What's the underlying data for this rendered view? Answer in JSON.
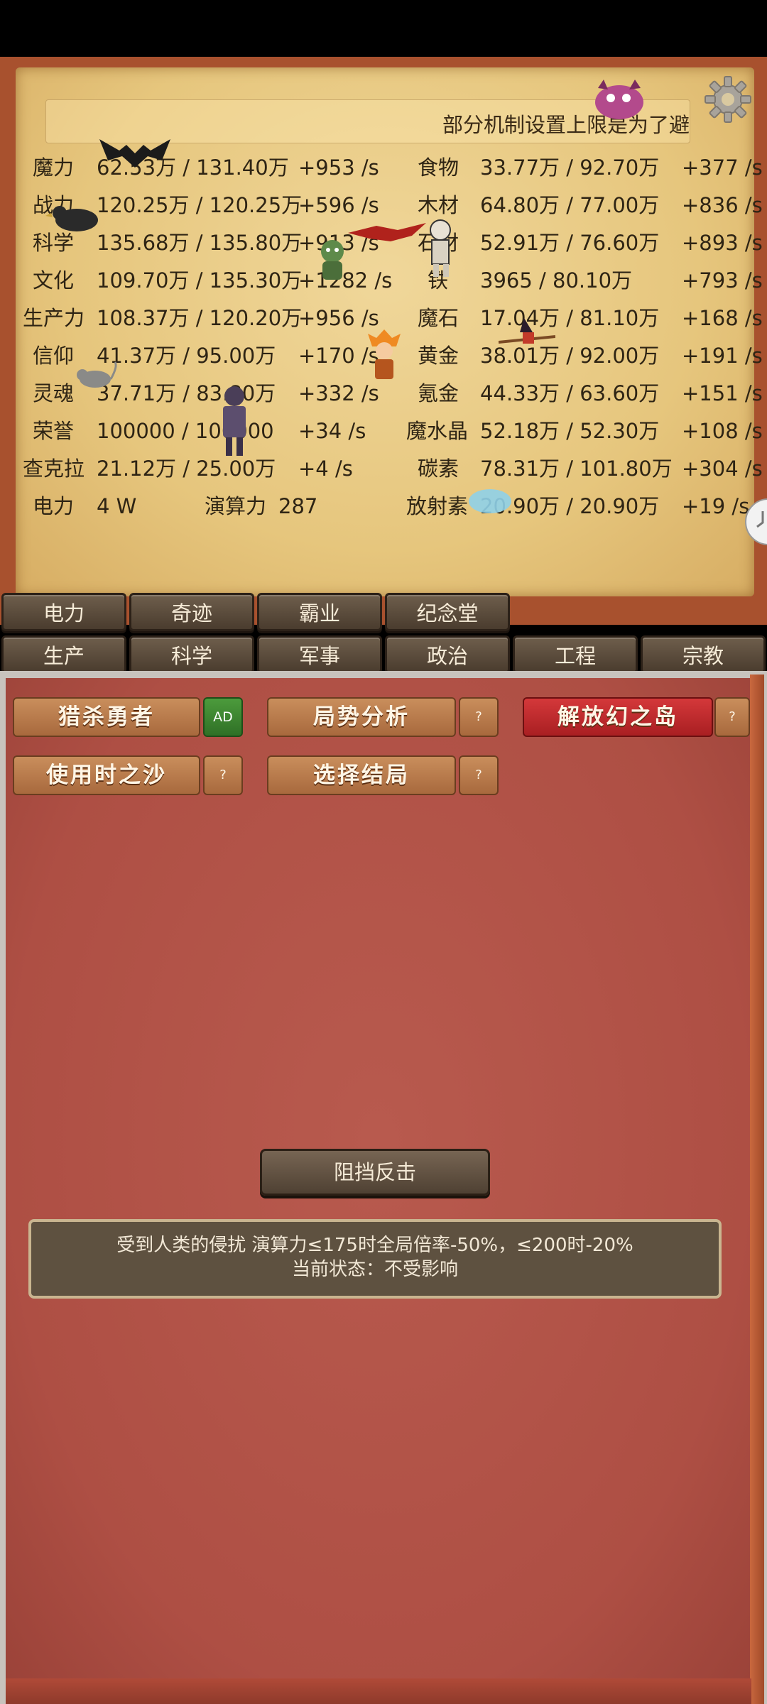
{
  "notice_text": "部分机制设置上限是为了避",
  "stats_left": [
    {
      "name": "魔力",
      "amount": "62.53万 / 131.40万",
      "rate": "+953 /s"
    },
    {
      "name": "战力",
      "amount": "120.25万 / 120.25万",
      "rate": "+596 /s"
    },
    {
      "name": "科学",
      "amount": "135.68万 / 135.80万",
      "rate": "+913 /s"
    },
    {
      "name": "文化",
      "amount": "109.70万 / 135.30万",
      "rate": "+1282 /s"
    },
    {
      "name": "生产力",
      "amount": "108.37万 / 120.20万",
      "rate": "+956 /s"
    },
    {
      "name": "信仰",
      "amount": "41.37万 / 95.00万",
      "rate": "+170 /s"
    },
    {
      "name": "灵魂",
      "amount": "37.71万 / 83.80万",
      "rate": "+332 /s"
    },
    {
      "name": "荣誉",
      "amount": "100000 / 100000",
      "rate": "+34 /s"
    },
    {
      "name": "查克拉",
      "amount": "21.12万 / 25.00万",
      "rate": "+4 /s"
    }
  ],
  "stats_right": [
    {
      "name": "食物",
      "amount": "33.77万 / 92.70万",
      "rate": "+377 /s"
    },
    {
      "name": "木材",
      "amount": "64.80万 / 77.00万",
      "rate": "+836 /s"
    },
    {
      "name": "石材",
      "amount": "52.91万 / 76.60万",
      "rate": "+893 /s"
    },
    {
      "name": "铁",
      "amount": "3965 / 80.10万",
      "rate": "+793 /s"
    },
    {
      "name": "魔石",
      "amount": "17.04万 / 81.10万",
      "rate": "+168 /s"
    },
    {
      "name": "黄金",
      "amount": "38.01万 / 92.00万",
      "rate": "+191 /s"
    },
    {
      "name": "氪金",
      "amount": "44.33万 / 63.60万",
      "rate": "+151 /s"
    },
    {
      "name": "魔水晶",
      "amount": "52.18万 / 52.30万",
      "rate": "+108 /s"
    },
    {
      "name": "碳素",
      "amount": "78.31万 / 101.80万",
      "rate": "+304 /s"
    }
  ],
  "last_row": {
    "power_label": "电力",
    "power_value": "4 W",
    "compute_label": "演算力",
    "compute_value": "287",
    "rad_label": "放射素",
    "rad_amount": "20.90万 / 20.90万",
    "rad_rate": "+19 /s"
  },
  "tabs_row1": [
    "电力",
    "奇迹",
    "霸业",
    "纪念堂"
  ],
  "tabs_row2": [
    "生产",
    "科学",
    "军事",
    "政治",
    "工程",
    "宗教"
  ],
  "actions": {
    "hunt_hero": "猎杀勇者",
    "ad": "AD",
    "analysis": "局势分析",
    "liberate": "解放幻之岛",
    "hourglass": "使用时之沙",
    "ending": "选择结局",
    "help": "?"
  },
  "block_button": "阻挡反击",
  "info": {
    "line1": "受到人类的侵扰 演算力≤175时全局倍率-50%，≤200时-20%",
    "line2": "当前状态：不受影响"
  }
}
